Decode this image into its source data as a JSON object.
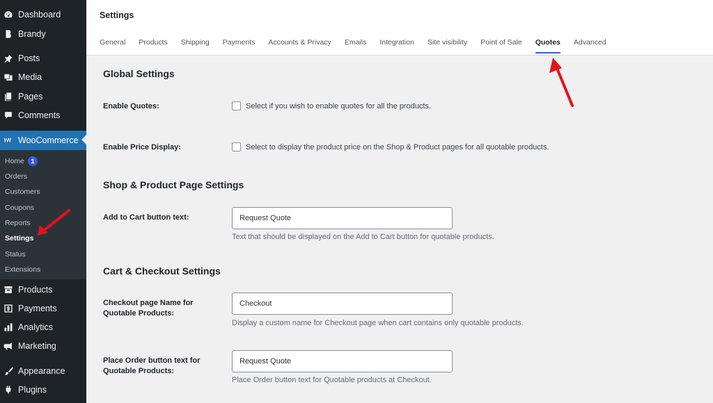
{
  "sidebar": {
    "top_items": [
      {
        "label": "Dashboard",
        "icon": "dashboard-icon"
      },
      {
        "label": "Brandy",
        "icon": "brandy-icon"
      },
      {
        "label": "Posts",
        "icon": "pin-icon"
      },
      {
        "label": "Media",
        "icon": "media-icon"
      },
      {
        "label": "Pages",
        "icon": "pages-icon"
      },
      {
        "label": "Comments",
        "icon": "comment-icon"
      },
      {
        "label": "WooCommerce",
        "icon": "woocommerce-icon"
      }
    ],
    "woo_submenu": [
      {
        "label": "Home",
        "badge": "1"
      },
      {
        "label": "Orders"
      },
      {
        "label": "Customers"
      },
      {
        "label": "Coupons"
      },
      {
        "label": "Reports"
      },
      {
        "label": "Settings"
      },
      {
        "label": "Status"
      },
      {
        "label": "Extensions"
      }
    ],
    "bottom_items": [
      {
        "label": "Products",
        "icon": "archive-icon"
      },
      {
        "label": "Payments",
        "icon": "dollar-icon"
      },
      {
        "label": "Analytics",
        "icon": "bar-chart-icon"
      },
      {
        "label": "Marketing",
        "icon": "megaphone-icon"
      },
      {
        "label": "Appearance",
        "icon": "paintbrush-icon"
      },
      {
        "label": "Plugins",
        "icon": "plugin-icon"
      }
    ]
  },
  "header": {
    "title": "Settings",
    "tabs": [
      "General",
      "Products",
      "Shipping",
      "Payments",
      "Accounts & Privacy",
      "Emails",
      "Integration",
      "Site visibility",
      "Point of Sale",
      "Quotes",
      "Advanced"
    ],
    "active_tab": "Quotes"
  },
  "global": {
    "title": "Global Settings",
    "enable_quotes_label": "Enable Quotes:",
    "enable_quotes_text": "Select if you wish to enable quotes for all the products.",
    "enable_price_label": "Enable Price Display:",
    "enable_price_text": "Select to display the product price on the Shop & Product pages for all quotable products."
  },
  "shop": {
    "title": "Shop & Product Page Settings",
    "add_to_cart_label": "Add to Cart button text:",
    "add_to_cart_value": "Request Quote",
    "add_to_cart_desc": "Text that should be displayed on the Add to Cart button for quotable products."
  },
  "checkout": {
    "title": "Cart & Checkout Settings",
    "checkout_name_label": "Checkout page Name for Quotable Products:",
    "checkout_name_value": "Checkout",
    "checkout_name_desc": "Display a custom name for Checkout page when cart contains only quotable products.",
    "place_order_label": "Place Order button text for Quotable Products:",
    "place_order_value": "Request Quote",
    "place_order_desc": "Place Order button text for Quotable products at Checkout."
  },
  "colors": {
    "accent": "#3858e9",
    "sidebar": "#1d2327",
    "active_menu": "#2271b1",
    "annotation": "#e2141b"
  }
}
